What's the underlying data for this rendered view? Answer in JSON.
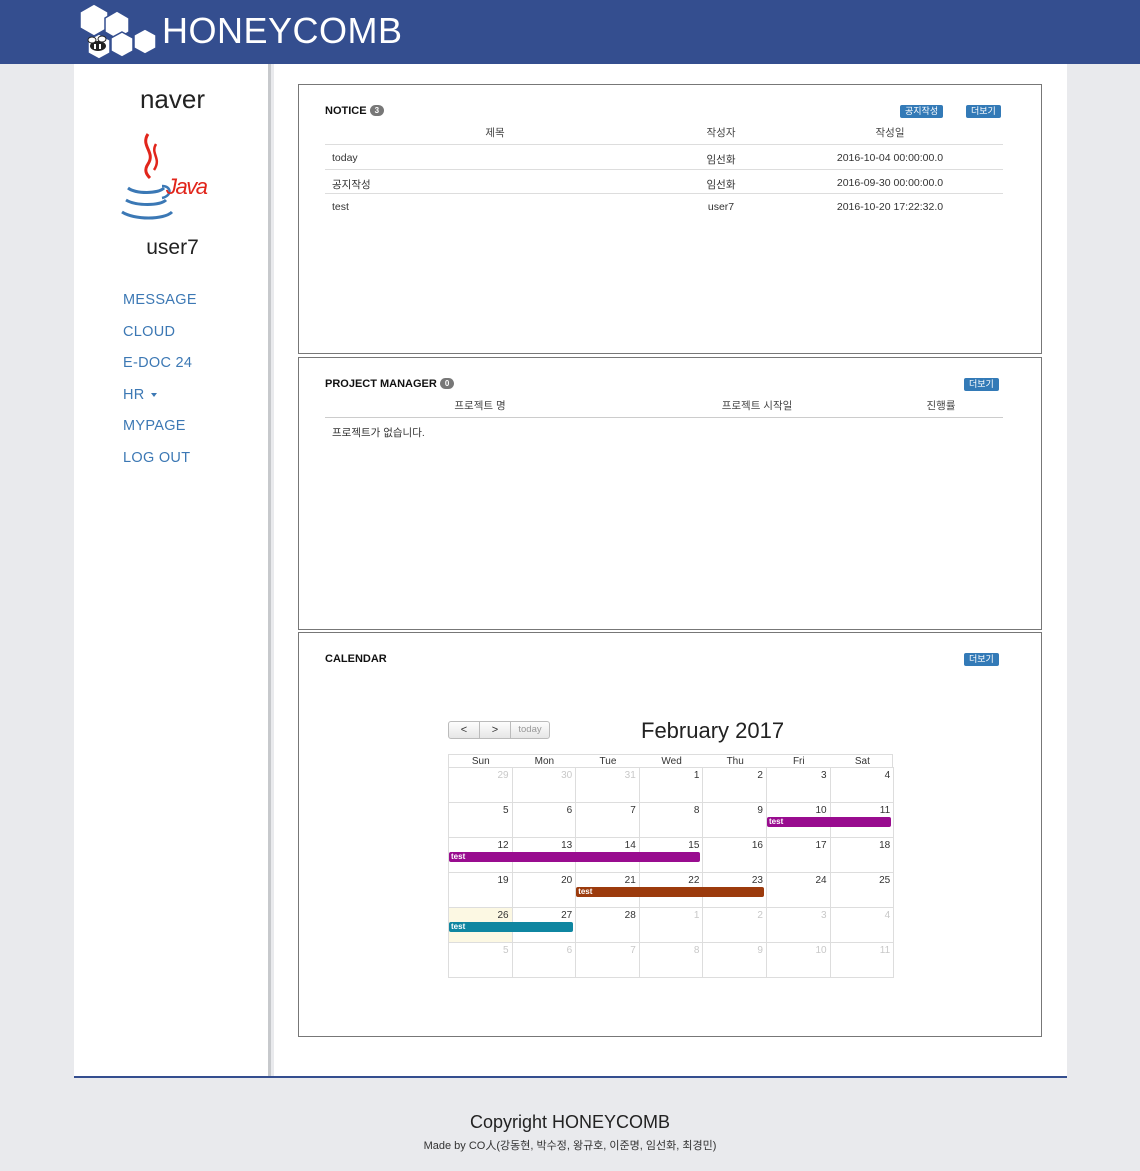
{
  "header": {
    "brand": "HONEYCOMB"
  },
  "sidebar": {
    "org": "naver",
    "user": "user7",
    "items": [
      {
        "label": "MESSAGE"
      },
      {
        "label": "CLOUD"
      },
      {
        "label": "E-DOC 24"
      },
      {
        "label": "HR"
      },
      {
        "label": "MYPAGE"
      },
      {
        "label": "LOG OUT"
      }
    ]
  },
  "notice": {
    "title": "NOTICE",
    "count": "3",
    "write_button": "공지작성",
    "more_button": "더보기",
    "columns": [
      "제목",
      "작성자",
      "작성일"
    ],
    "rows": [
      {
        "title": "today",
        "author": "임선화",
        "date": "2016-10-04 00:00:00.0"
      },
      {
        "title": "공지작성",
        "author": "임선화",
        "date": "2016-09-30 00:00:00.0"
      },
      {
        "title": "test",
        "author": "user7",
        "date": "2016-10-20 17:22:32.0"
      }
    ]
  },
  "project": {
    "title": "PROJECT MANAGER",
    "count": "0",
    "more_button": "더보기",
    "columns": [
      "프로젝트 명",
      "프로젝트 시작일",
      "진행률"
    ],
    "empty": "프로젝트가 없습니다."
  },
  "calendar": {
    "title": "CALENDAR",
    "more_button": "더보기",
    "prev": "<",
    "next": ">",
    "today": "today",
    "month": "February 2017",
    "weekdays": [
      "Sun",
      "Mon",
      "Tue",
      "Wed",
      "Thu",
      "Fri",
      "Sat"
    ],
    "weeks": [
      [
        "29",
        "30",
        "31",
        "1",
        "2",
        "3",
        "4"
      ],
      [
        "5",
        "6",
        "7",
        "8",
        "9",
        "10",
        "11"
      ],
      [
        "12",
        "13",
        "14",
        "15",
        "16",
        "17",
        "18"
      ],
      [
        "19",
        "20",
        "21",
        "22",
        "23",
        "24",
        "25"
      ],
      [
        "26",
        "27",
        "28",
        "1",
        "2",
        "3",
        "4"
      ],
      [
        "5",
        "6",
        "7",
        "8",
        "9",
        "10",
        "11"
      ]
    ],
    "events": [
      {
        "label": "test",
        "week": 1,
        "start": 5,
        "end": 6,
        "color": "#990c8f"
      },
      {
        "label": "test",
        "week": 2,
        "start": 0,
        "end": 3,
        "color": "#990c8f"
      },
      {
        "label": "test",
        "week": 3,
        "start": 2,
        "end": 4,
        "color": "#9c3b0d"
      },
      {
        "label": "test",
        "week": 4,
        "start": 0,
        "end": 1,
        "color": "#0f86a1"
      }
    ]
  },
  "footer": {
    "copyright": "Copyright HONEYCOMB",
    "credits": "Made by CO人(강동현, 박수정, 왕규호, 이준명, 임선화, 최경민)"
  },
  "colors": {
    "header_bg": "#344e8f",
    "link": "#3c78b4",
    "button": "#337ab7"
  }
}
